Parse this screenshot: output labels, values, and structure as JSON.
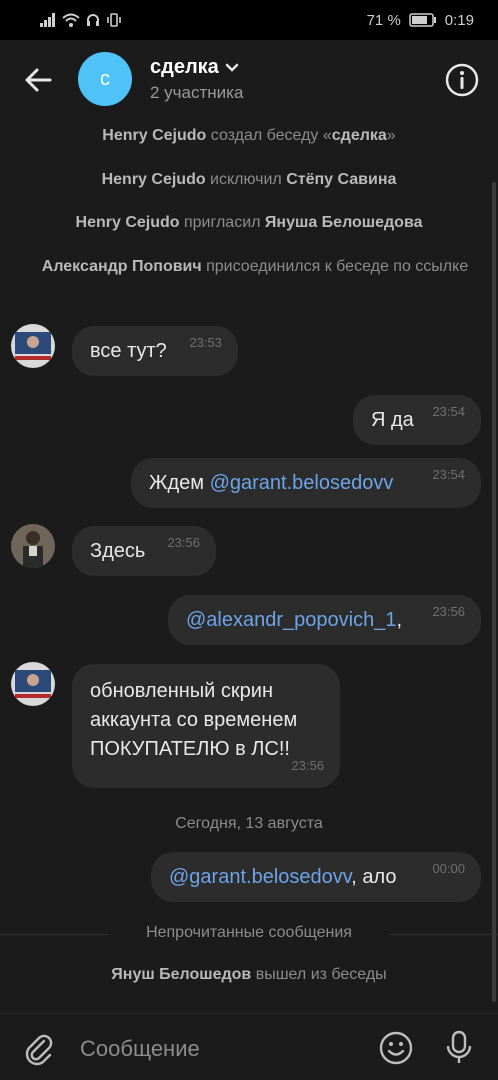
{
  "status_bar": {
    "battery": "71 %",
    "time": "0:19"
  },
  "header": {
    "title": "сделка",
    "subtitle": "2 участника",
    "avatar_letter": "с"
  },
  "service": [
    {
      "actor": "Henry Cejudo",
      "text": " создал беседу «",
      "target": "сделка",
      "tail": "»"
    },
    {
      "actor": "Henry Cejudo",
      "text": " исключил ",
      "target": "Стёпу Савина",
      "tail": ""
    },
    {
      "actor": "Henry Cejudo",
      "text": " пригласил ",
      "target": "Януша Белошедова",
      "tail": ""
    },
    {
      "actor": "Александр Попович",
      "text": " присоединился к беседе по ссылке",
      "target": "",
      "tail": ""
    }
  ],
  "messages": [
    {
      "text": "все тут?",
      "time": "23:53"
    },
    {
      "text": "Я да",
      "time": "23:54"
    },
    {
      "prefix": "Ждем ",
      "mention": "@garant.belosedovv",
      "time": "23:54"
    },
    {
      "text": "Здесь",
      "time": "23:56"
    },
    {
      "mention": "@alexandr_popovich_1",
      "suffix": ",",
      "time": "23:56"
    },
    {
      "line1": "обновленный скрин",
      "line2": "аккаунта со временем",
      "line3": "ПОКУПАТЕЛЮ в ЛС!!",
      "time": "23:56"
    },
    {
      "mention": "@garant.belosedovv",
      "suffix": ", ало",
      "time": "00:00"
    }
  ],
  "date_separator": "Сегодня, 13 августа",
  "unread_label": "Непрочитанные сообщения",
  "left_service": {
    "actor": "Януш Белошедов",
    "text": " вышел из беседы"
  },
  "composer": {
    "placeholder": "Сообщение"
  }
}
